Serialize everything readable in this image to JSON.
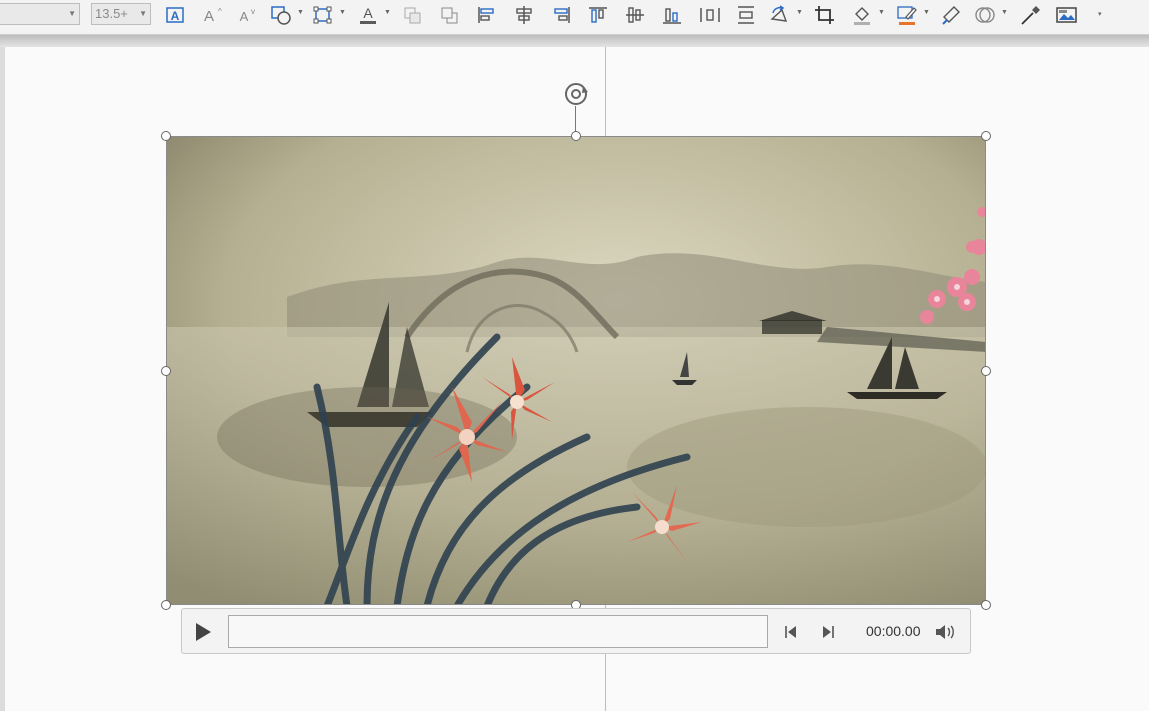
{
  "toolbar": {
    "font_combo_value": "",
    "font_size_value": "13.5+",
    "buttons": [
      {
        "name": "text-box-button",
        "icon": "text-box-icon"
      },
      {
        "name": "increase-font-button",
        "icon": "increase-font-icon"
      },
      {
        "name": "decrease-font-button",
        "icon": "decrease-font-icon"
      },
      {
        "name": "insert-shape-button",
        "icon": "shapes-icon"
      },
      {
        "name": "edit-points-button",
        "icon": "edit-points-icon"
      },
      {
        "name": "font-color-button",
        "icon": "font-color-icon"
      },
      {
        "name": "bring-forward-button",
        "icon": "bring-forward-icon"
      },
      {
        "name": "send-backward-button",
        "icon": "send-backward-icon"
      },
      {
        "name": "align-left-button",
        "icon": "align-left-icon"
      },
      {
        "name": "align-center-button",
        "icon": "align-center-icon"
      },
      {
        "name": "align-right-button",
        "icon": "align-right-icon"
      },
      {
        "name": "align-top-button",
        "icon": "align-top-icon"
      },
      {
        "name": "align-middle-button",
        "icon": "align-middle-icon"
      },
      {
        "name": "align-bottom-button",
        "icon": "align-bottom-icon"
      },
      {
        "name": "distribute-horizontally-button",
        "icon": "distribute-horizontal-icon"
      },
      {
        "name": "distribute-vertically-button",
        "icon": "distribute-vertical-icon"
      },
      {
        "name": "rotate-button",
        "icon": "rotate-icon"
      },
      {
        "name": "crop-button",
        "icon": "crop-icon"
      },
      {
        "name": "fill-color-button",
        "icon": "paint-bucket-icon"
      },
      {
        "name": "outline-color-button",
        "icon": "pen-outline-icon"
      },
      {
        "name": "format-painter-button",
        "icon": "format-painter-icon"
      },
      {
        "name": "shape-effects-button",
        "icon": "shape-effects-icon"
      },
      {
        "name": "eyedropper-button",
        "icon": "eyedropper-icon"
      },
      {
        "name": "picture-frame-button",
        "icon": "picture-icon"
      }
    ],
    "colors": {
      "font_color_bar": "#5a5a5a",
      "fill_bar": "#b0b0b0",
      "outline_bar": "#e8742b",
      "accent_blue": "#2b6cc4"
    }
  },
  "media_player": {
    "time_display": "00:00.00",
    "progress": 0
  }
}
